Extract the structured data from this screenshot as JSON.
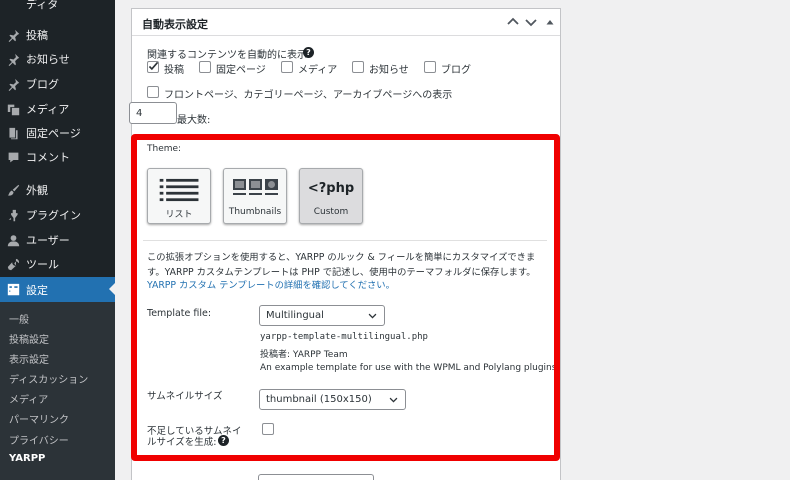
{
  "sidebar": {
    "top_partial": "ディタ",
    "items": [
      {
        "label": "投稿",
        "icon": "pushpin-icon"
      },
      {
        "label": "お知らせ",
        "icon": "pushpin-icon"
      },
      {
        "label": "ブログ",
        "icon": "pushpin-icon"
      },
      {
        "label": "メディア",
        "icon": "media-icon"
      },
      {
        "label": "固定ページ",
        "icon": "page-icon"
      },
      {
        "label": "コメント",
        "icon": "comment-icon"
      },
      {
        "label": "外観",
        "icon": "appearance-icon"
      },
      {
        "label": "プラグイン",
        "icon": "plugin-icon"
      },
      {
        "label": "ユーザー",
        "icon": "user-icon"
      },
      {
        "label": "ツール",
        "icon": "wrench-icon"
      },
      {
        "label": "設定",
        "icon": "settings-icon",
        "active": true
      }
    ],
    "submenu": [
      "一般",
      "投稿設定",
      "表示設定",
      "ディスカッション",
      "メディア",
      "パーマリンク",
      "プライバシー",
      "YARPP"
    ]
  },
  "postbox": {
    "title": "自動表示設定",
    "content_label": "関連するコンテンツを自動的に表示:",
    "content_types": [
      {
        "label": "投稿",
        "checked": true
      },
      {
        "label": "固定ページ",
        "checked": false
      },
      {
        "label": "メディア",
        "checked": false
      },
      {
        "label": "お知らせ",
        "checked": false
      },
      {
        "label": "ブログ",
        "checked": false
      }
    ],
    "archive_label": "フロントページ、カテゴリーページ、アーカイブページへの表示",
    "max_posts_label": "投稿の最大数:",
    "max_posts_value": "4",
    "theme_label": "Theme:",
    "themes": [
      {
        "label": "リスト",
        "icon": "list-icon"
      },
      {
        "label": "Thumbnails",
        "icon": "thumbnails-icon"
      },
      {
        "label": "Custom",
        "icon": "php-icon",
        "glyph": "<?php",
        "selected": true
      }
    ],
    "desc_line1": "この拡張オプションを使用すると、YARPP のルック & フィールを簡単にカスタマイズできま",
    "desc_line2": "す。YARPP カスタムテンプレートは PHP で記述し、使用中のテーマフォルダに保存します。",
    "desc_link": "YARPP カスタム テンプレートの詳細を確認してください。",
    "template_file_label": "Template file:",
    "template_file_value": "Multilingual",
    "template_filename": "yarpp-template-multilingual.php",
    "template_author": "投稿者: YARPP Team",
    "template_description": "An example template for use with the WPML and Polylang plugins",
    "thumb_size_label": "サムネイルサイズ",
    "thumb_size_value": "thumbnail (150x150)",
    "generate_label_line1": "不足しているサムネイ",
    "generate_label_line2": "ルサイズを生成:",
    "help_glyph": "?"
  }
}
